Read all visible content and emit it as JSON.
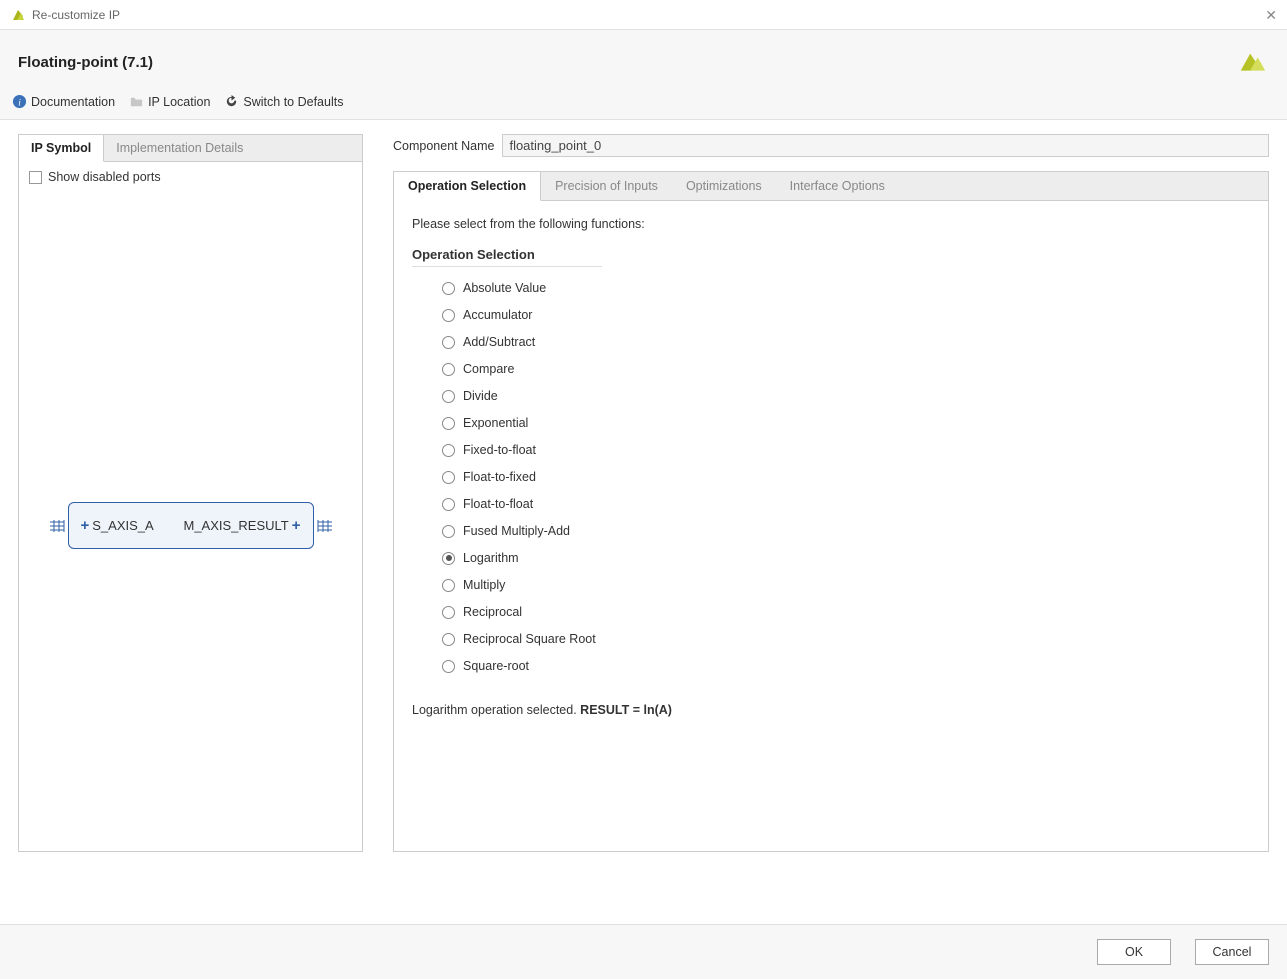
{
  "window": {
    "title": "Re-customize IP"
  },
  "header": {
    "title": "Floating-point (7.1)"
  },
  "toolbar": {
    "documentation": "Documentation",
    "ip_location": "IP Location",
    "switch_defaults": "Switch to Defaults"
  },
  "left_panel": {
    "tabs": {
      "symbol": "IP Symbol",
      "impl": "Implementation Details"
    },
    "show_disabled_label": "Show disabled ports",
    "show_disabled_checked": false,
    "ports": {
      "in": "S_AXIS_A",
      "out": "M_AXIS_RESULT"
    }
  },
  "component_name": {
    "label": "Component Name",
    "value": "floating_point_0"
  },
  "config_tabs": {
    "op_sel": "Operation Selection",
    "precision": "Precision of Inputs",
    "optim": "Optimizations",
    "iface": "Interface Options"
  },
  "config": {
    "instruction": "Please select from the following functions:",
    "group_label": "Operation Selection",
    "selected": "Logarithm",
    "operations": [
      "Absolute Value",
      "Accumulator",
      "Add/Subtract",
      "Compare",
      "Divide",
      "Exponential",
      "Fixed-to-float",
      "Float-to-fixed",
      "Float-to-float",
      "Fused Multiply-Add",
      "Logarithm",
      "Multiply",
      "Reciprocal",
      "Reciprocal Square Root",
      "Square-root"
    ],
    "result_prefix": "Logarithm operation selected. ",
    "result_formula": "RESULT = ln(A)"
  },
  "footer": {
    "ok": "OK",
    "cancel": "Cancel"
  }
}
